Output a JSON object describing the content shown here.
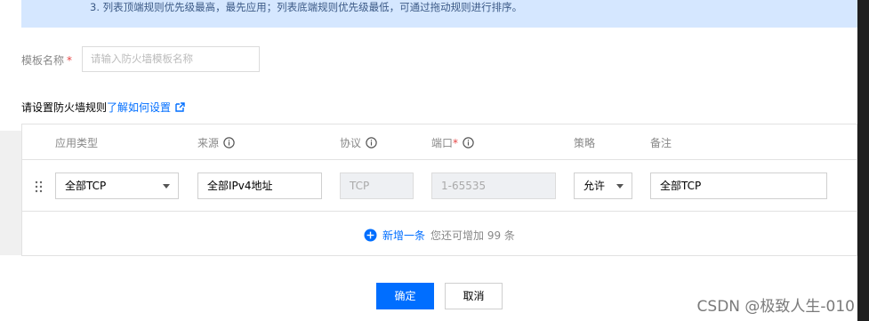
{
  "notice": {
    "text": "3. 列表顶端规则优先级最高，最先应用；列表底端规则优先级最低，可通过拖动规则进行排序。"
  },
  "form": {
    "template_name_label": "模板名称",
    "required_mark": "*",
    "template_name_placeholder": "请输入防火墙模板名称"
  },
  "rules": {
    "title_prefix": "请设置防火墙规则",
    "help_link": "了解如何设置"
  },
  "table": {
    "headers": {
      "app_type": "应用类型",
      "source": "来源",
      "protocol": "协议",
      "port": "端口",
      "port_required": "*",
      "policy": "策略",
      "remark": "备注"
    },
    "row": {
      "app_type": "全部TCP",
      "source": "全部IPv4地址",
      "protocol": "TCP",
      "port": "1-65535",
      "policy": "允许",
      "remark": "全部TCP"
    },
    "add_label": "新增一条",
    "add_hint": "您还可增加 99 条"
  },
  "buttons": {
    "confirm": "确定",
    "cancel": "取消"
  },
  "watermark": "CSDN @极致人生-010",
  "colors": {
    "accent": "#006eff",
    "required": "#e54545",
    "notice_bg": "#d5e7ff"
  }
}
